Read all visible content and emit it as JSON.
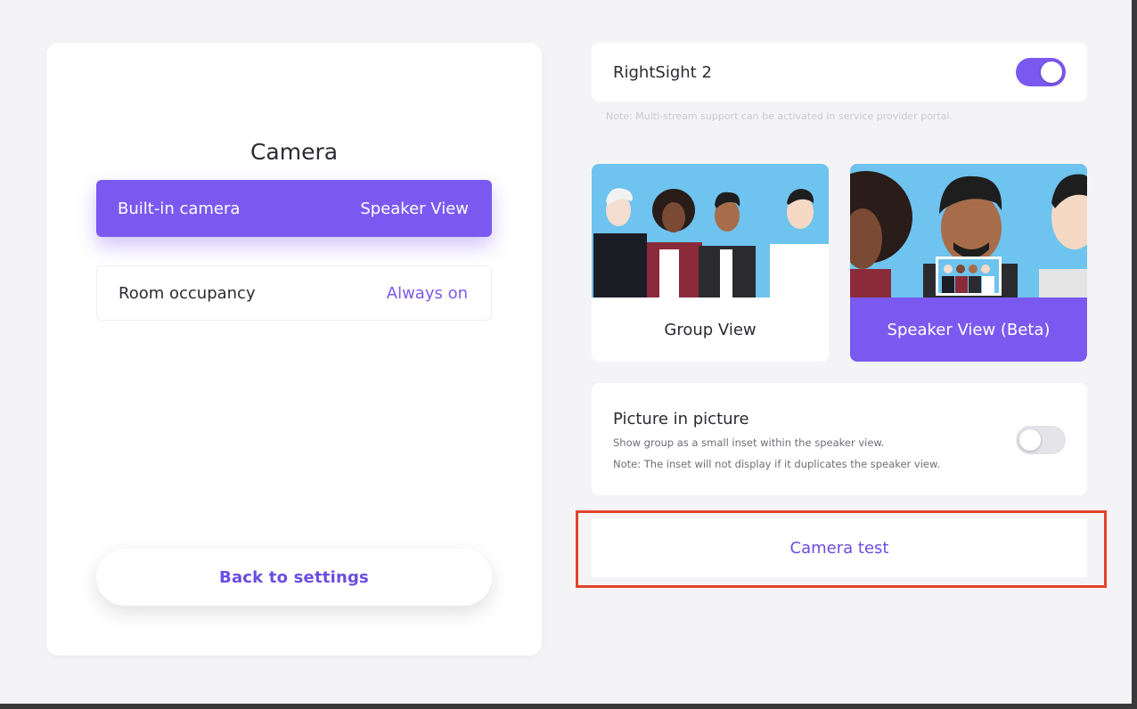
{
  "camera_panel": {
    "title": "Camera",
    "items": [
      {
        "label": "Built-in camera",
        "value": "Speaker View"
      },
      {
        "label": "Room occupancy",
        "value": "Always on"
      }
    ],
    "back_label": "Back to settings"
  },
  "rightsight": {
    "label": "RightSight 2",
    "enabled": true,
    "note": "Note: Multi-stream support can be activated in service provider portal."
  },
  "views": [
    {
      "label": "Group View",
      "selected": false
    },
    {
      "label": "Speaker View (Beta)",
      "selected": true
    }
  ],
  "pip": {
    "title": "Picture in picture",
    "desc1": "Show group as a small inset within the speaker view.",
    "desc2": "Note: The inset will not display if it duplicates the speaker view.",
    "enabled": false
  },
  "camera_test_label": "Camera test",
  "colors": {
    "accent": "#7b59f0",
    "highlight": "#e0432b",
    "sky": "#6ec3ef"
  }
}
